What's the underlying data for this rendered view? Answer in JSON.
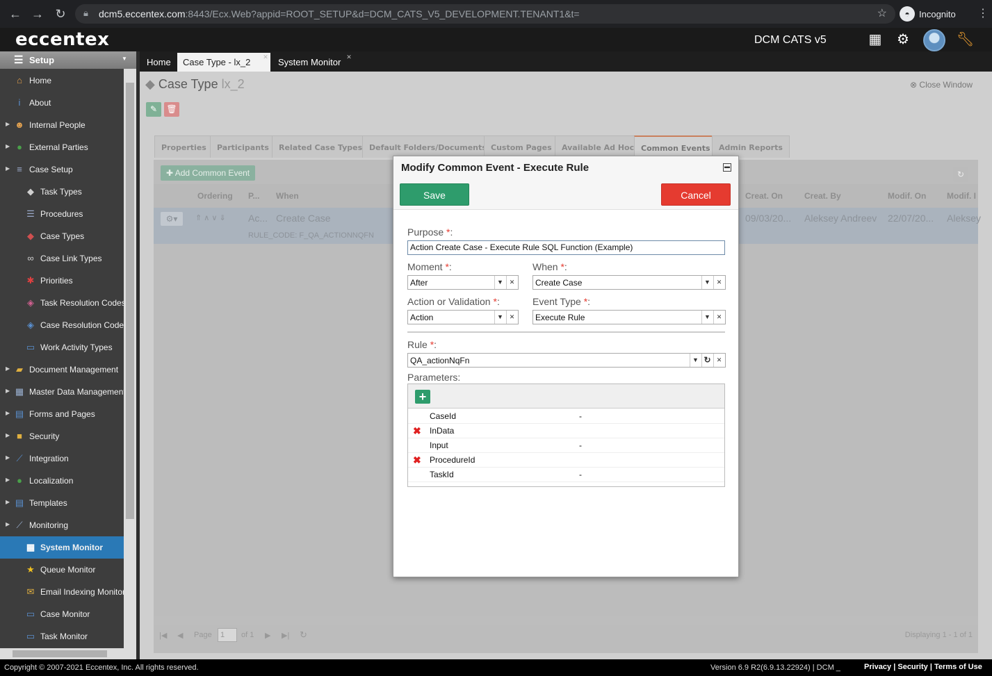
{
  "browser": {
    "url_host": "dcm5.eccentex.com",
    "url_rest": ":8443/Ecx.Web?appid=ROOT_SETUP&d=DCM_CATS_V5_DEVELOPMENT.TENANT1&t=",
    "profile": "Incognito"
  },
  "app": {
    "logo": "eccentex",
    "title": "DCM CATS v5"
  },
  "sidebar": {
    "header": "Setup",
    "items": [
      {
        "label": "Home",
        "icon": "home-icon",
        "glyph": "⌂"
      },
      {
        "label": "About",
        "icon": "info-icon",
        "glyph": "i"
      },
      {
        "label": "Internal People",
        "icon": "people-icon",
        "glyph": "☻"
      },
      {
        "label": "External Parties",
        "icon": "globe-icon",
        "glyph": "●"
      },
      {
        "label": "Case Setup",
        "icon": "case-setup-icon",
        "glyph": "≡"
      },
      {
        "label": "Task Types",
        "icon": "cubes-icon",
        "glyph": "◆"
      },
      {
        "label": "Procedures",
        "icon": "procedures-icon",
        "glyph": "☰"
      },
      {
        "label": "Case Types",
        "icon": "case-types-icon",
        "glyph": "◆"
      },
      {
        "label": "Case Link Types",
        "icon": "link-icon",
        "glyph": "∞"
      },
      {
        "label": "Priorities",
        "icon": "asterisk-icon",
        "glyph": "✱"
      },
      {
        "label": "Task Resolution Codes",
        "icon": "tag-icon",
        "glyph": "◈"
      },
      {
        "label": "Case Resolution Codes",
        "icon": "tag-icon",
        "glyph": "◈"
      },
      {
        "label": "Work Activity Types",
        "icon": "monitor-icon",
        "glyph": "▭"
      },
      {
        "label": "Document Management",
        "icon": "folder-icon",
        "glyph": "▰"
      },
      {
        "label": "Master Data Management",
        "icon": "table-icon",
        "glyph": "▦"
      },
      {
        "label": "Forms and Pages",
        "icon": "form-icon",
        "glyph": "▤"
      },
      {
        "label": "Security",
        "icon": "lock-icon",
        "glyph": "■"
      },
      {
        "label": "Integration",
        "icon": "plug-icon",
        "glyph": "⟋"
      },
      {
        "label": "Localization",
        "icon": "globe-icon",
        "glyph": "●"
      },
      {
        "label": "Templates",
        "icon": "template-icon",
        "glyph": "▤"
      },
      {
        "label": "Monitoring",
        "icon": "monitoring-icon",
        "glyph": "⟋"
      },
      {
        "label": "System Monitor",
        "icon": "system-monitor-icon",
        "glyph": "▦"
      },
      {
        "label": "Queue Monitor",
        "icon": "star-icon",
        "glyph": "★"
      },
      {
        "label": "Email Indexing Monitor",
        "icon": "email-monitor-icon",
        "glyph": "✉"
      },
      {
        "label": "Case Monitor",
        "icon": "case-monitor-icon",
        "glyph": "▭"
      },
      {
        "label": "Task Monitor",
        "icon": "task-monitor-icon",
        "glyph": "▭"
      }
    ]
  },
  "tabs": [
    "Home",
    "Case Type - lx_2",
    "System Monitor"
  ],
  "page": {
    "title": "Case Type",
    "subtitle": "lx_2",
    "close_window": "Close Window"
  },
  "property_tabs": [
    "Properties",
    "Participants",
    "Related Case Types",
    "Default Folders/Documents",
    "Custom Pages",
    "Available Ad Hoc",
    "Common Events",
    "Admin Reports"
  ],
  "grid": {
    "add_button": "Add Common Event",
    "columns": [
      "Ordering",
      "P...",
      "When",
      "Creat. On",
      "Creat. By",
      "Modif. On",
      "Modif. I"
    ],
    "row": {
      "purpose": "Ac...",
      "when": "Create Case",
      "rule_code": "RULE_CODE: F_QA_ACTIONNQFN",
      "created_on": "09/03/20...",
      "created_by": "Aleksey Andreev",
      "modified_on": "22/07/20...",
      "modified_by": "Aleksey"
    },
    "pager": {
      "page_label": "Page",
      "page_value": "1",
      "of_label": "of 1",
      "displaying": "Displaying 1 - 1 of 1"
    }
  },
  "modal": {
    "title": "Modify Common Event - Execute Rule",
    "save": "Save",
    "cancel": "Cancel",
    "purpose_label": "Purpose",
    "purpose_value": "Action Create Case - Execute Rule SQL Function (Example)",
    "moment_label": "Moment",
    "moment_value": "After",
    "when_label": "When",
    "when_value": "Create Case",
    "action_label": "Action or Validation",
    "action_value": "Action",
    "event_type_label": "Event Type",
    "event_type_value": "Execute Rule",
    "rule_label": "Rule",
    "rule_value": "QA_actionNqFn",
    "parameters_label": "Parameters:",
    "required_mark": "*",
    "colon": ":",
    "parameters": [
      {
        "name": "CaseId",
        "value": "-",
        "deletable": false
      },
      {
        "name": "InData",
        "value": "",
        "deletable": true
      },
      {
        "name": "Input",
        "value": "-",
        "deletable": false
      },
      {
        "name": "ProcedureId",
        "value": "",
        "deletable": true
      },
      {
        "name": "TaskId",
        "value": "-",
        "deletable": false
      }
    ]
  },
  "footer": {
    "copyright": "Copyright © 2007-2021 Eccentex, Inc. All rights reserved.",
    "version": "Version   6.9 R2(6.9.13.22924) | DCM _",
    "links": [
      "Privacy",
      "Security",
      "Terms of Use"
    ]
  }
}
